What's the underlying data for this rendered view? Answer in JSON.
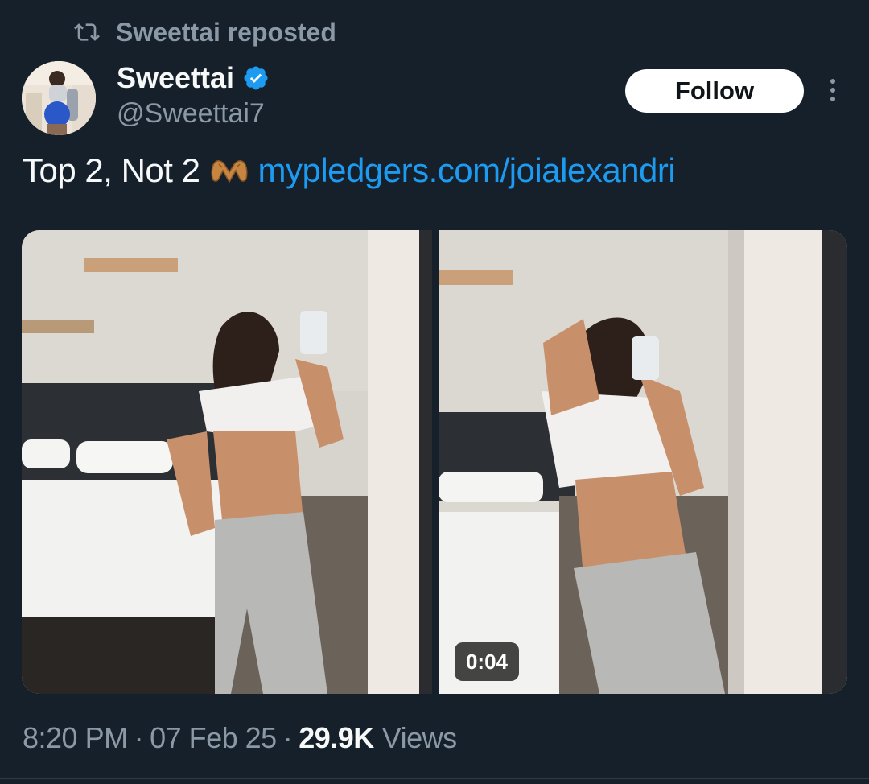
{
  "repost": {
    "icon": "repost-icon",
    "text": "Sweettai reposted"
  },
  "author": {
    "display_name": "Sweettai",
    "handle": "@Sweettai7",
    "verified_icon": "verified-badge-icon",
    "verified_color": "#1d9bf0"
  },
  "actions": {
    "follow_label": "Follow",
    "more_icon": "more-options-icon"
  },
  "tweet": {
    "text": "Top 2, Not 2",
    "emoji_icon": "heart-hands-emoji",
    "link": "mypledgers.com/joialexandri",
    "link_color": "#1d9bf0"
  },
  "media": {
    "video_duration": "0:04"
  },
  "meta": {
    "time": "8:20 PM",
    "separator": "·",
    "date": "07 Feb 25",
    "views_count": "29.9K",
    "views_label": "Views"
  }
}
